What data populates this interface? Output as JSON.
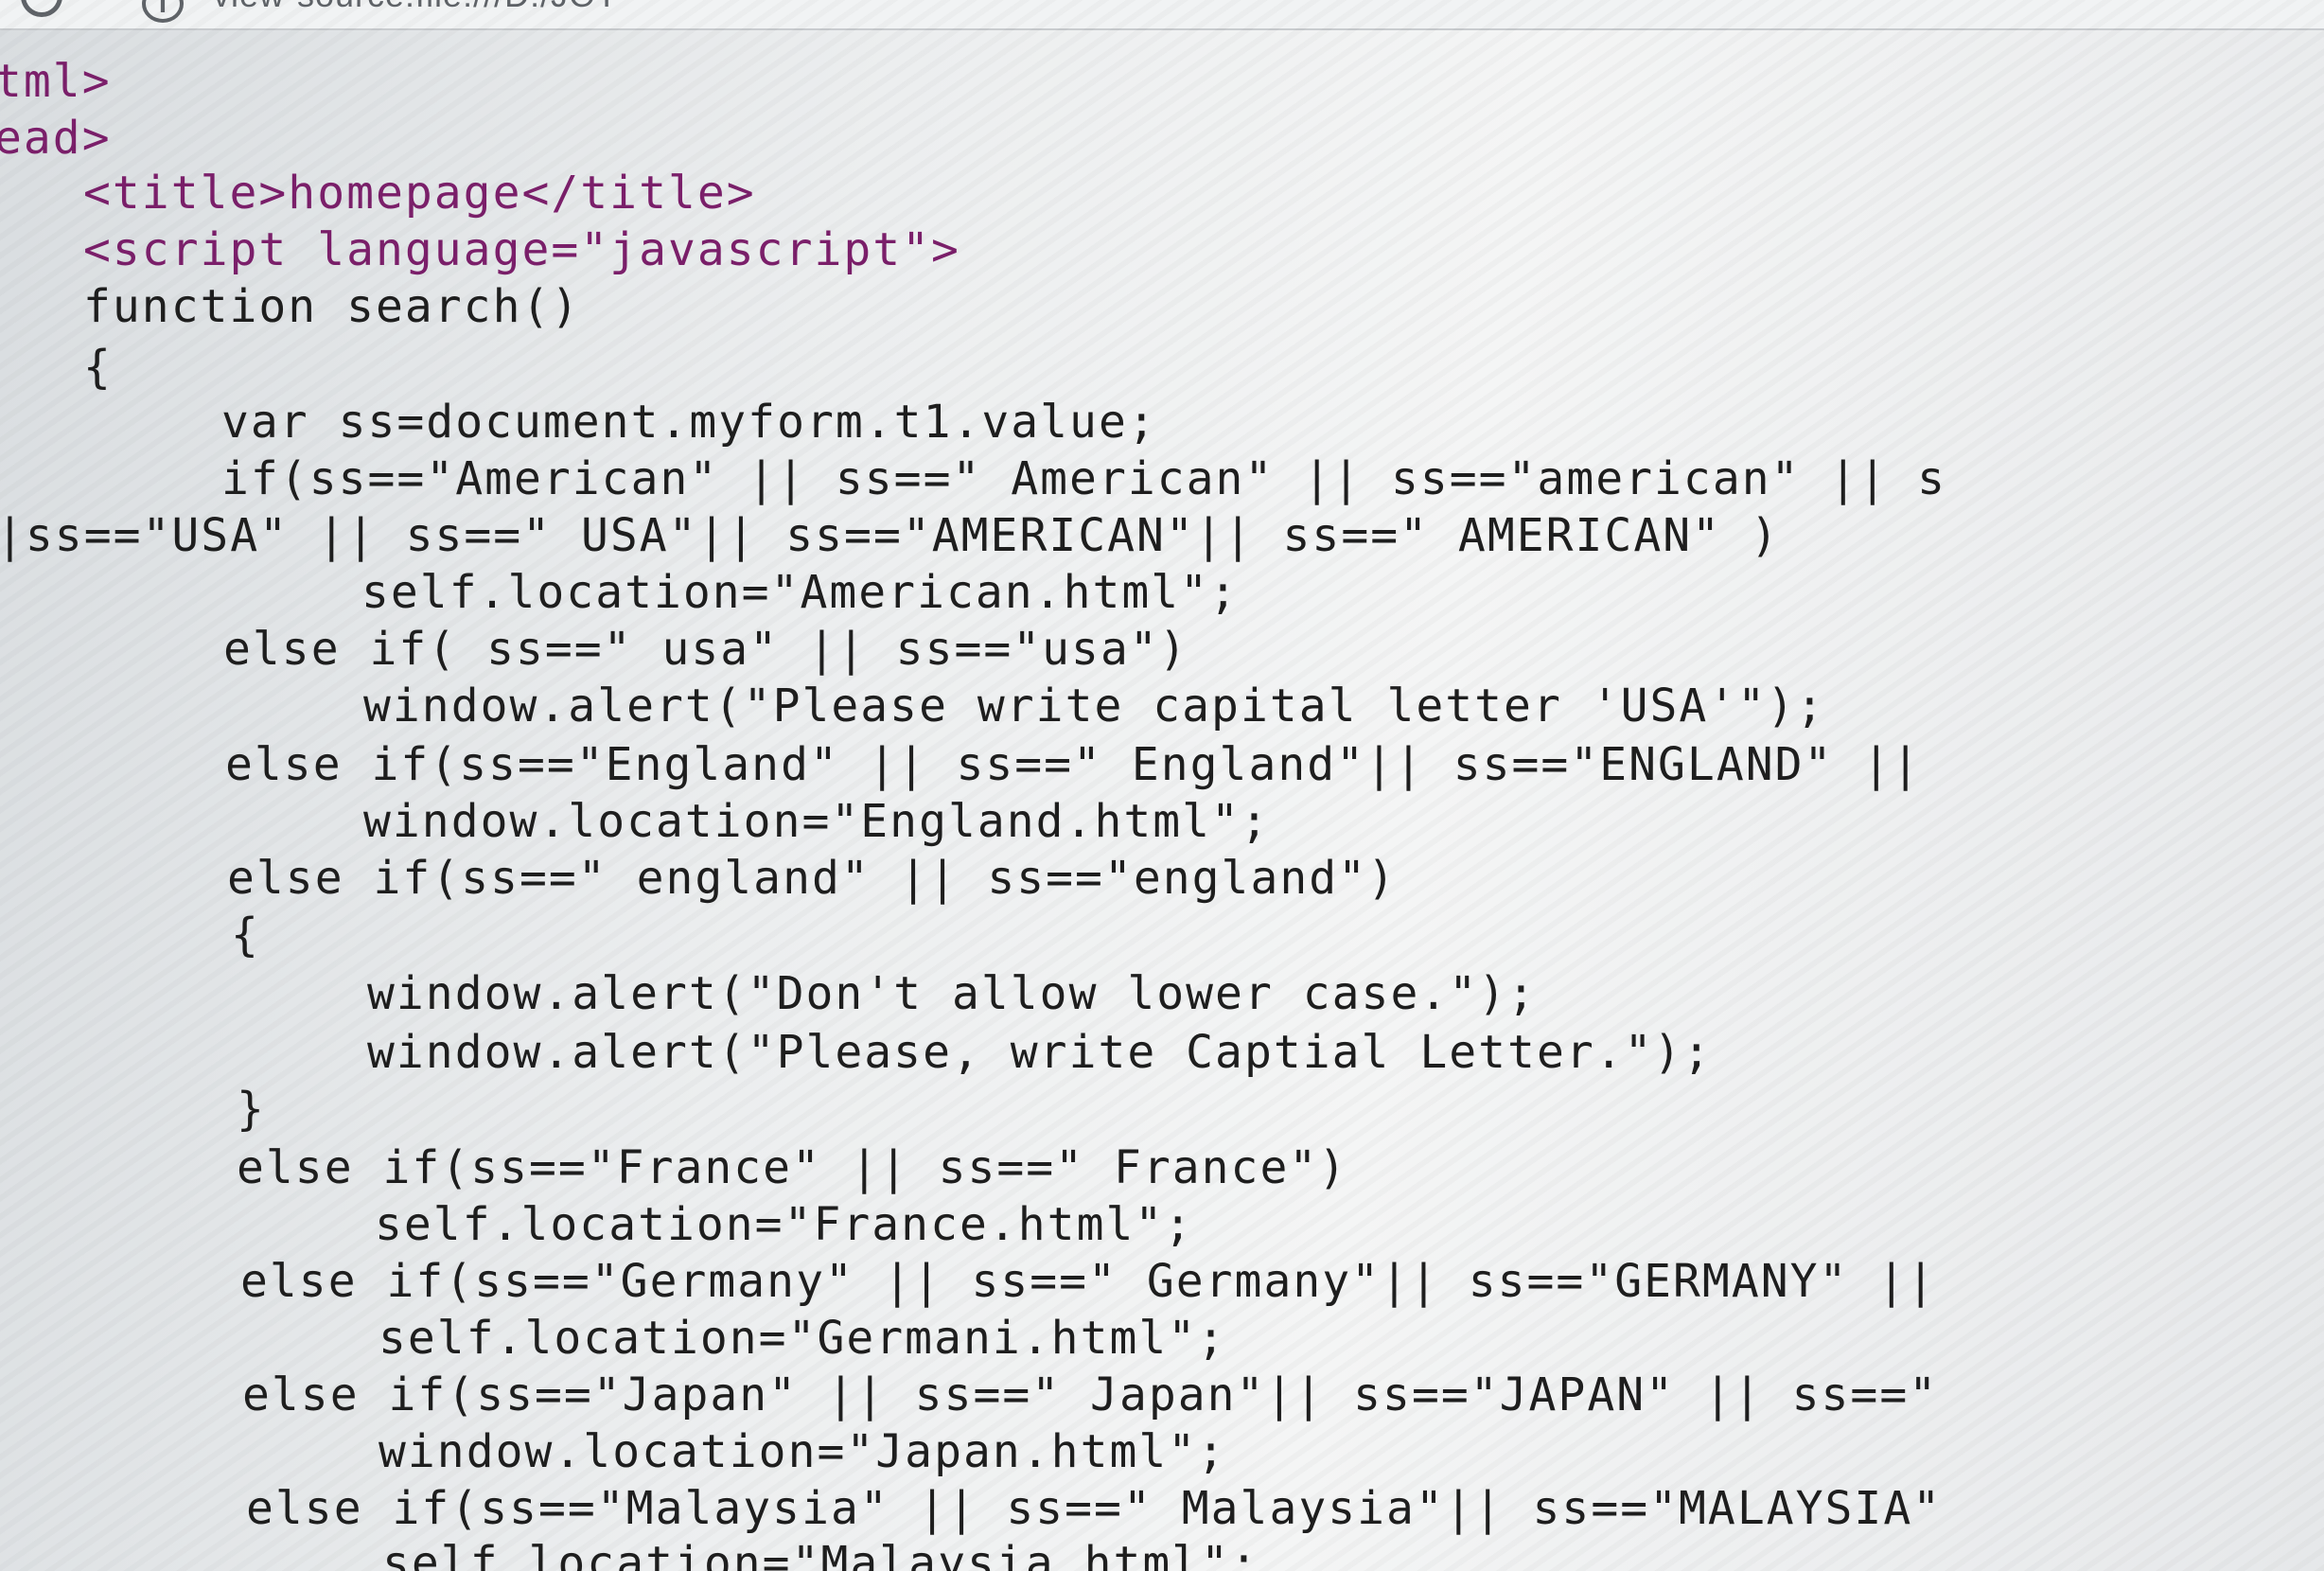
{
  "browser": {
    "url": "view-source:file:///D:/JOY/Countrysearch/search.html",
    "url_visible_fragment": "view-source:file:///D:/JOT"
  },
  "source_lines": [
    "tml>",
    "ead>",
    "<title>homepage</title>",
    "<script language=\"javascript\">",
    "function search()",
    "{",
    "var ss=document.myform.t1.value;",
    "if(ss==\"American\" || ss==\" American\" || ss==\"american\" || s",
    "|ss==\"USA\" || ss==\" USA\"|| ss==\"AMERICAN\"|| ss==\" AMERICAN\" )",
    "self.location=\"American.html\";",
    "else if( ss==\" usa\" || ss==\"usa\")",
    "window.alert(\"Please write capital letter 'USA'\");",
    "else if(ss==\"England\" || ss==\" England\"|| ss==\"ENGLAND\" ||",
    "window.location=\"England.html\";",
    "else if(ss==\" england\" || ss==\"england\")",
    "{",
    "window.alert(\"Don't allow lower case.\");",
    "window.alert(\"Please, write Captial Letter.\");",
    "}",
    "else if(ss==\"France\" || ss==\" France\")",
    "self.location=\"France.html\";",
    "else if(ss==\"Germany\" || ss==\" Germany\"|| ss==\"GERMANY\" ||",
    "self.location=\"Germani.html\";",
    "else if(ss==\"Japan\" || ss==\" Japan\"|| ss==\"JAPAN\" || ss==\"",
    "window.location=\"Japan.html\";",
    "else if(ss==\"Malaysia\" || ss==\" Malaysia\"|| ss==\"MALAYSIA\"",
    "self.location=\"Malaysia.html\";"
  ]
}
